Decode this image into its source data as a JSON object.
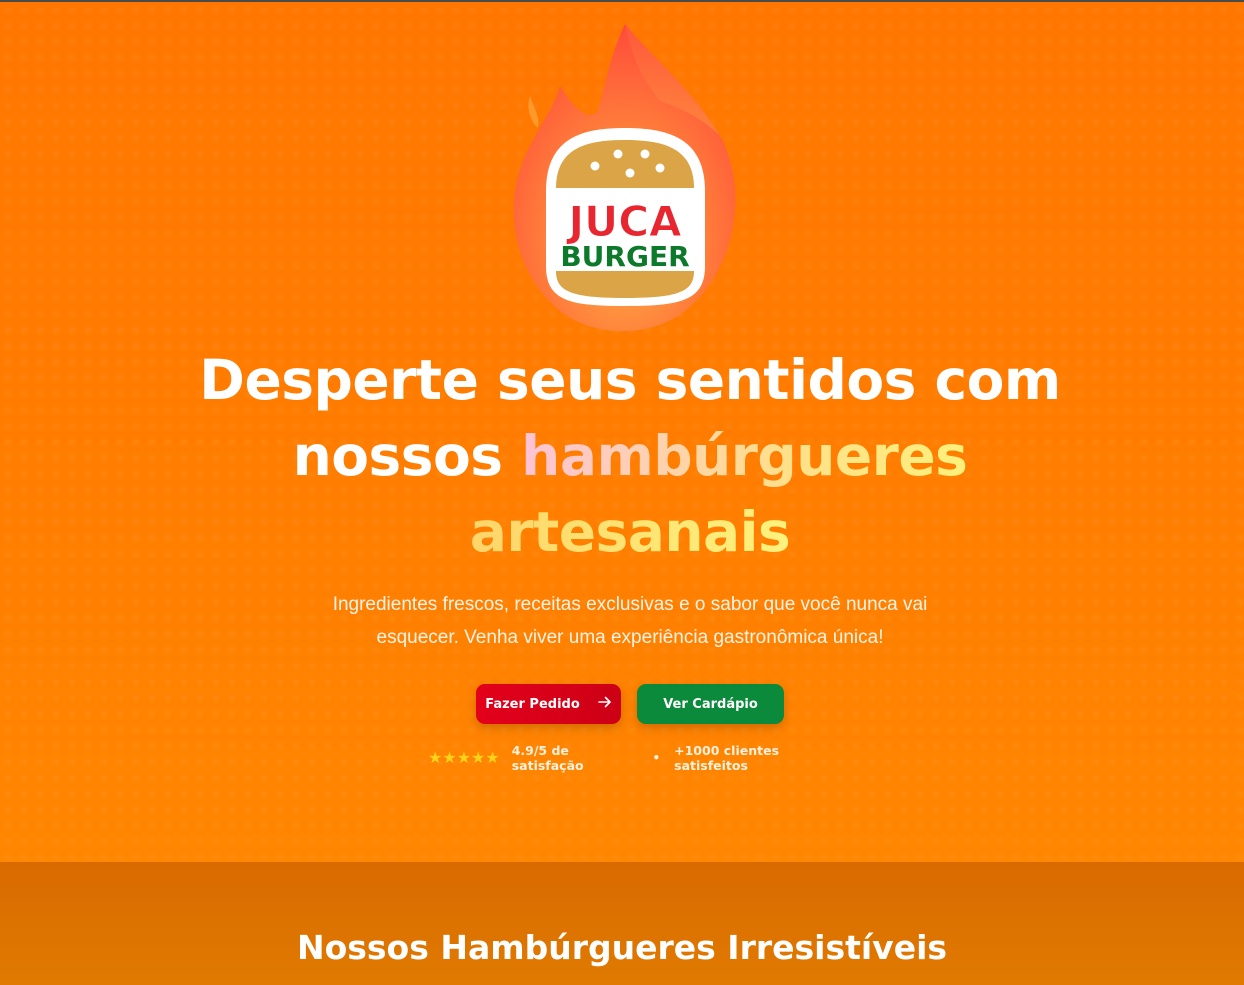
{
  "brand": {
    "logo_line1": "JUCA",
    "logo_line2": "BURGER",
    "colors": {
      "primary_bg": "#ff7a00",
      "logo_red": "#e8262f",
      "logo_green": "#0c7a2a",
      "bun": "#dba446",
      "order_button": "#e3001b",
      "menu_button": "#0a8a3a",
      "star": "#ffd21a"
    }
  },
  "hero": {
    "headline_part1": "Desperte seus sentidos com",
    "headline_part2": "nossos",
    "headline_highlight1": "hambúrgueres",
    "headline_highlight2": "artesanais",
    "subtitle_line1": "Ingredientes frescos, receitas exclusivas e o sabor que você nunca vai",
    "subtitle_line2": "esquecer. Venha viver uma experiência gastronômica única!",
    "order_button_label": "Fazer Pedido",
    "order_button_icon": "arrow-right-icon",
    "menu_button_label": "Ver Cardápio",
    "rating_stars": 5,
    "rating_text": "4.9/5 de satisfação",
    "separator": "•",
    "clients_text": "+1000 clientes satisfeitos"
  },
  "products_section": {
    "title": "Nossos Hambúrgueres Irresistíveis"
  }
}
